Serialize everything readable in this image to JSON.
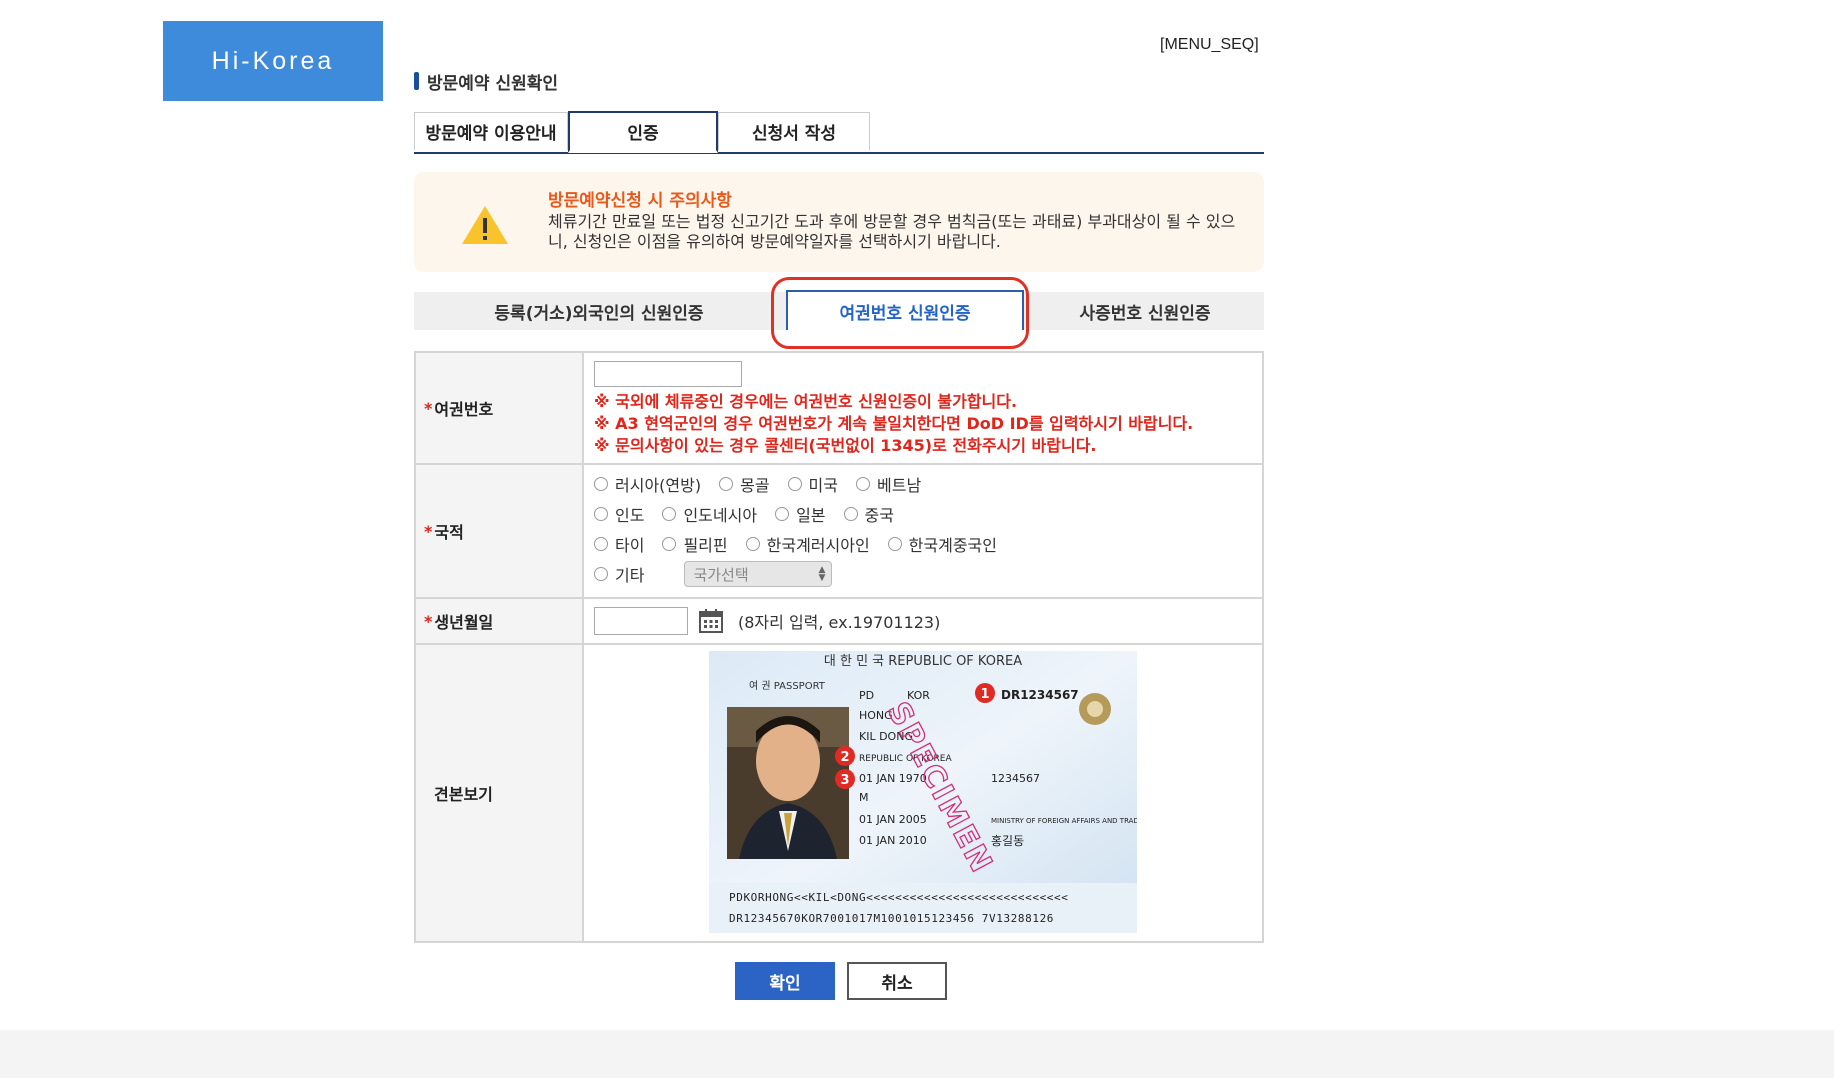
{
  "logo": "Hi-Korea",
  "menu_seq": "[MENU_SEQ]",
  "page_title": "방문예약 신원확인",
  "tabs": [
    "방문예약 이용안내",
    "인증",
    "신청서 작성"
  ],
  "notice": {
    "title": "방문예약신청 시 주의사항",
    "text": "체류기간 만료일 또는 법정 신고기간 도과 후에 방문할 경우 범칙금(또는 과태료) 부과대상이 될 수 있으니, 신청인은 이점을 유의하여 방문예약일자를 선택하시기 바랍니다."
  },
  "auth_tabs": [
    "등록(거소)외국인의 신원인증",
    "여권번호 신원인증",
    "사증번호 신원인증"
  ],
  "form": {
    "passport": {
      "label": "여권번호",
      "notes": [
        "※ 국외에 체류중인 경우에는 여권번호 신원인증이 불가합니다.",
        "※ A3 현역군인의 경우 여권번호가 계속 불일치한다면 DoD ID를 입력하시기 바랍니다.",
        "※ 문의사항이 있는 경우 콜센터(국번없이 1345)로 전화주시기 바랍니다."
      ]
    },
    "nationality": {
      "label": "국적",
      "options": [
        "러시아(연방)",
        "몽골",
        "미국",
        "베트남",
        "인도",
        "인도네시아",
        "일본",
        "중국",
        "타이",
        "필리핀",
        "한국계러시아인",
        "한국계중국인",
        "기타"
      ],
      "select_placeholder": "국가선택"
    },
    "birth": {
      "label": "생년월일",
      "hint": "(8자리 입력, ex.19701123)"
    },
    "sample": {
      "label": "견본보기",
      "header": "대 한 민 국   REPUBLIC OF KOREA",
      "doc_title": "여 권  PASSPORT",
      "type_val": "PD",
      "country_val": "KOR",
      "passport_no": "DR1234567",
      "surname": "HONG",
      "given": "KIL DONG",
      "nationality_val": "REPUBLIC OF KOREA",
      "dob": "01 JAN 1970",
      "personal_no": "1234567",
      "sex": "M",
      "issue": "01 JAN 2005",
      "authority": "MINISTRY OF FOREIGN AFFAIRS AND TRADE",
      "expiry": "01 JAN 2010",
      "korean_name": "홍길동",
      "watermark": "SPECIMEN",
      "markers": [
        "1",
        "2",
        "3"
      ],
      "mrz1": "PDKORHONG<<KIL<DONG<<<<<<<<<<<<<<<<<<<<<<<<<<<<",
      "mrz2": "DR12345670KOR7001017M1001015123456 7V13288126"
    }
  },
  "buttons": {
    "confirm": "확인",
    "cancel": "취소"
  }
}
